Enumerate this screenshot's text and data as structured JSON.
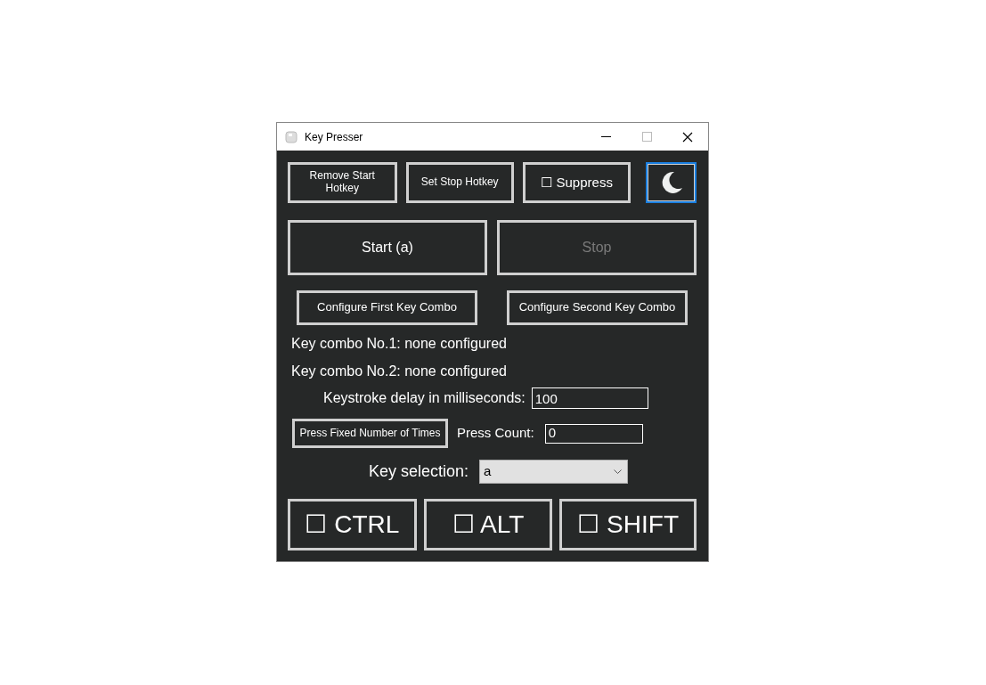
{
  "window": {
    "title": "Key Presser"
  },
  "top_buttons": [
    {
      "label": "Remove Start Hotkey",
      "kind": "text"
    },
    {
      "label": "Set Stop Hotkey",
      "kind": "text"
    },
    {
      "label": "☐ Suppress",
      "kind": "text"
    },
    {
      "kind": "moon",
      "focused": true
    }
  ],
  "main_buttons": [
    {
      "label": "Start (a)",
      "disabled": false
    },
    {
      "label": "Stop",
      "disabled": true
    }
  ],
  "config_buttons": [
    "Configure First Key Combo",
    "Configure Second Key Combo"
  ],
  "combo_status": [
    "Key combo No.1: none configured",
    "Key combo No.2: none configured"
  ],
  "delay": {
    "label": "Keystroke delay in milliseconds:",
    "value": "100"
  },
  "press_fixed": {
    "button": "Press Fixed Number of Times",
    "label": "Press Count:",
    "value": "0"
  },
  "key_selection": {
    "label": "Key selection:",
    "value": "a"
  },
  "modifiers": [
    "☐ CTRL",
    "☐ ALT",
    "☐ SHIFT"
  ]
}
